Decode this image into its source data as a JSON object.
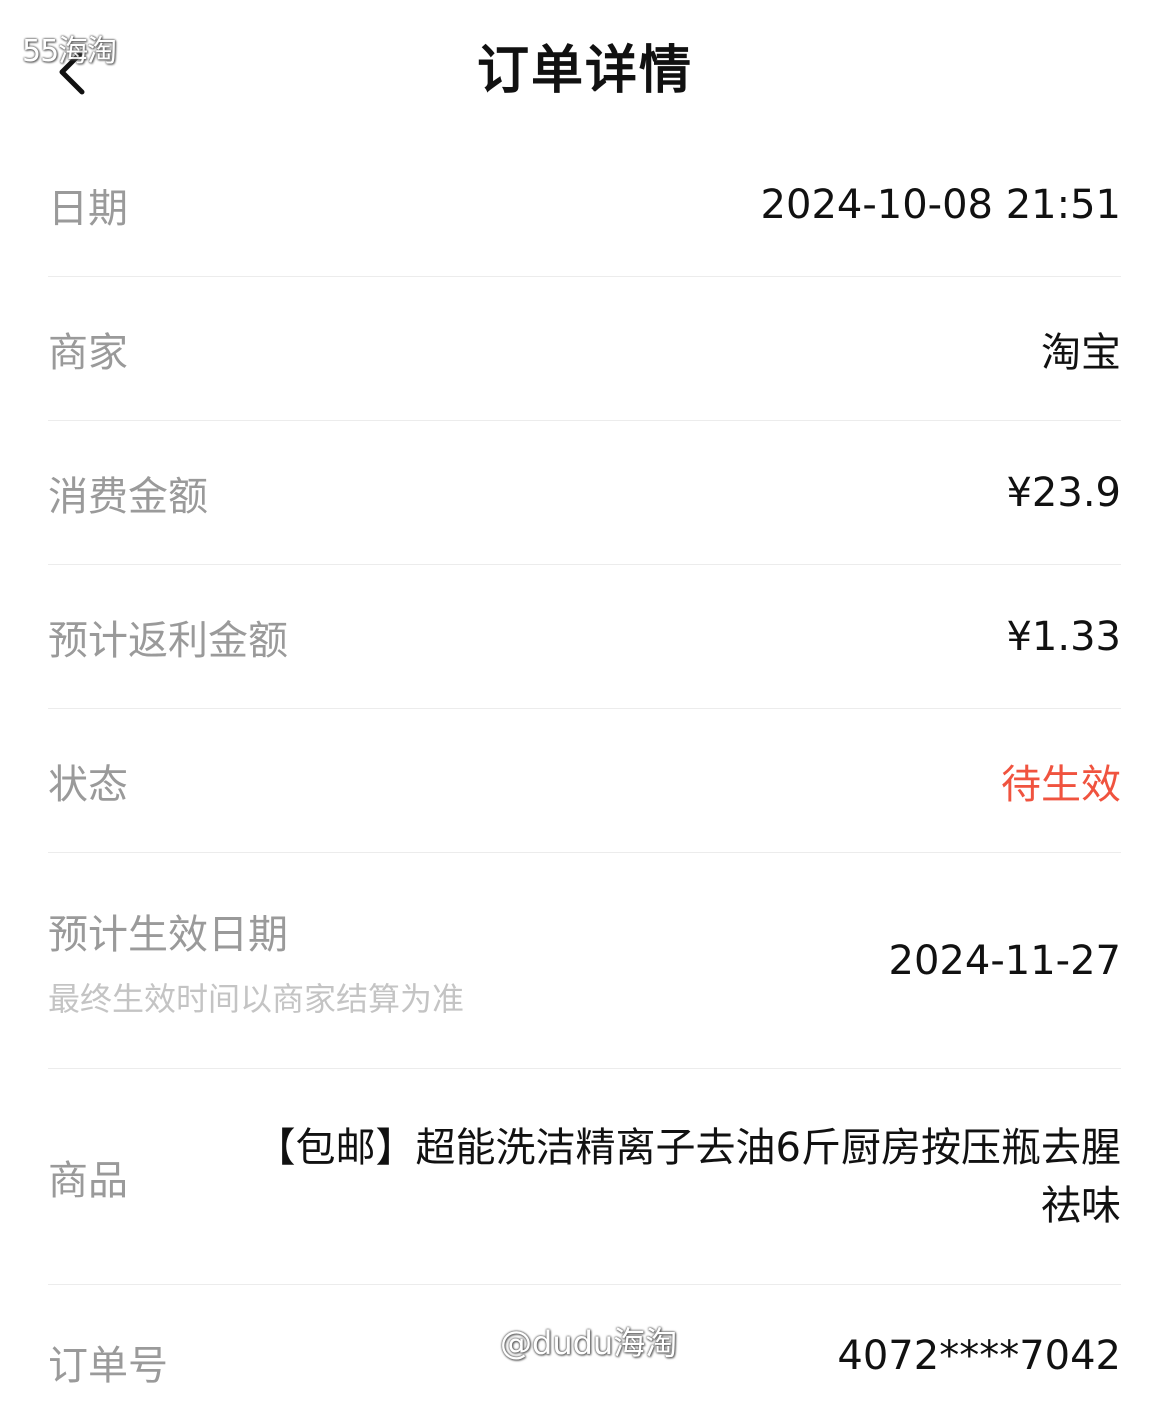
{
  "header": {
    "title": "订单详情",
    "back_icon": "chevron-left-icon",
    "watermark": "55海淘"
  },
  "rows": {
    "date": {
      "label": "日期",
      "value": "2024-10-08 21:51"
    },
    "merchant": {
      "label": "商家",
      "value": "淘宝"
    },
    "amount": {
      "label": "消费金额",
      "value": "¥23.9"
    },
    "rebate": {
      "label": "预计返利金额",
      "value": "¥1.33"
    },
    "status": {
      "label": "状态",
      "value": "待生效",
      "color": "#f0533f"
    },
    "effective_date": {
      "label": "预计生效日期",
      "note": "最终生效时间以商家结算为准",
      "value": "2024-11-27"
    },
    "goods": {
      "label": "商品",
      "value": "【包邮】超能洗洁精离子去油6斤厨房按压瓶去腥祛味"
    },
    "order_no": {
      "label": "订单号",
      "value": "4072****7042"
    }
  },
  "watermark_bottom": "@dudu海淘"
}
